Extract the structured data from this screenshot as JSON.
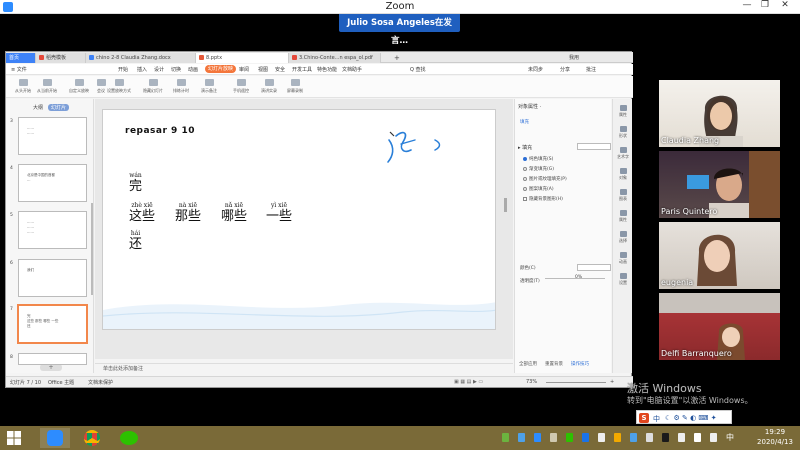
{
  "window": {
    "title": "Zoom"
  },
  "speaker_banner": "Julio Sosa Angeles在发言…",
  "tabs": [
    {
      "label": "首页",
      "kind": "home"
    },
    {
      "label": "稻壳模板",
      "kind": "normal",
      "color": "#e5483a"
    },
    {
      "label": "chino 2-8 Claudia Zhang.docx",
      "kind": "normal",
      "color": "#3e82f7"
    },
    {
      "label": "8.pptx",
      "kind": "active",
      "color": "#e5593a"
    },
    {
      "label": "3.Chino-Conte...n espa_ol.pdf",
      "kind": "normal",
      "color": "#e5483a"
    }
  ],
  "user": "我用",
  "menu": {
    "file": "≡ 文件",
    "items": [
      "开始",
      "插入",
      "设计",
      "切换",
      "动画",
      "幻灯片放映",
      "审阅",
      "视图",
      "安全",
      "开发工具",
      "特色功能",
      "文档助手"
    ],
    "selected": "幻灯片放映",
    "search": "Q 查找",
    "right": [
      "未同步",
      "分享",
      "批注"
    ]
  },
  "toolbar": [
    "从头开始",
    "从当前开始",
    "自定义放映",
    "会议",
    "设置放映方式",
    "隐藏幻灯片",
    "排练计时",
    "演示备注",
    "手机遥控",
    "演讲实录",
    "屏幕录制"
  ],
  "left_pane": {
    "tabs": [
      "大纲",
      "幻灯片"
    ],
    "thumbs": [
      {
        "num": "3",
        "lines": [
          "……",
          "……"
        ]
      },
      {
        "num": "4",
        "lines": [
          "北京是中国的首都",
          "…"
        ]
      },
      {
        "num": "5",
        "lines": [
          "……",
          "……",
          "……"
        ]
      },
      {
        "num": "6",
        "lines": [
          "我们"
        ]
      },
      {
        "num": "7",
        "lines": [
          "完",
          "这些 那些 哪些 一些",
          "还"
        ]
      },
      {
        "num": "8",
        "lines": []
      }
    ]
  },
  "slide": {
    "title": "repasar 9 10",
    "words": [
      {
        "py": "wán",
        "hz": "完"
      },
      {
        "py": "zhè xiē",
        "hz": "这些"
      },
      {
        "py": "nà xiē",
        "hz": "那些"
      },
      {
        "py": "nǎ xiē",
        "hz": "哪些"
      },
      {
        "py": "yì xiē",
        "hz": "一些"
      },
      {
        "py": "hái",
        "hz": "还"
      }
    ]
  },
  "notes": "单击此处添加备注",
  "right_panel": {
    "title": "对象属性 ·",
    "subtitle": "填充",
    "section": "▸ 填充",
    "options": [
      "纯色填充(S)",
      "渐变填充(G)",
      "图片或纹理填充(P)",
      "图案填充(A)",
      "隐藏背景图形(H)"
    ],
    "color_label": "颜色(C)",
    "transparency_label": "透明度(T)",
    "transparency_value": "0%",
    "buttons": [
      "全部应用",
      "重置背景",
      "操作技巧"
    ]
  },
  "right_bar": [
    "属性",
    "形状",
    "艺术字",
    "对象",
    "图表",
    "属性",
    "选择",
    "动画",
    "设置"
  ],
  "status": {
    "slide": "幻灯片 7 / 10",
    "theme": "Office 主题",
    "protect": "文档未保护",
    "zoom": "73%"
  },
  "participants": [
    {
      "name": "Claudia Zhang"
    },
    {
      "name": "Paris Quintero"
    },
    {
      "name": "eugenia"
    },
    {
      "name": "Delfi Barranquero"
    }
  ],
  "watermark": {
    "line1": "激活 Windows",
    "line2": "转到\"电脑设置\"以激活 Windows。"
  },
  "ime": {
    "logo": "S",
    "lang": "中"
  },
  "clock": {
    "time": "19:29",
    "date": "2020/4/13"
  },
  "colors": {
    "zoom_blue": "#2d8cff",
    "accent_orange": "#f4763b",
    "banner": "#1f5fbf",
    "taskbar": "#7a6a38"
  }
}
